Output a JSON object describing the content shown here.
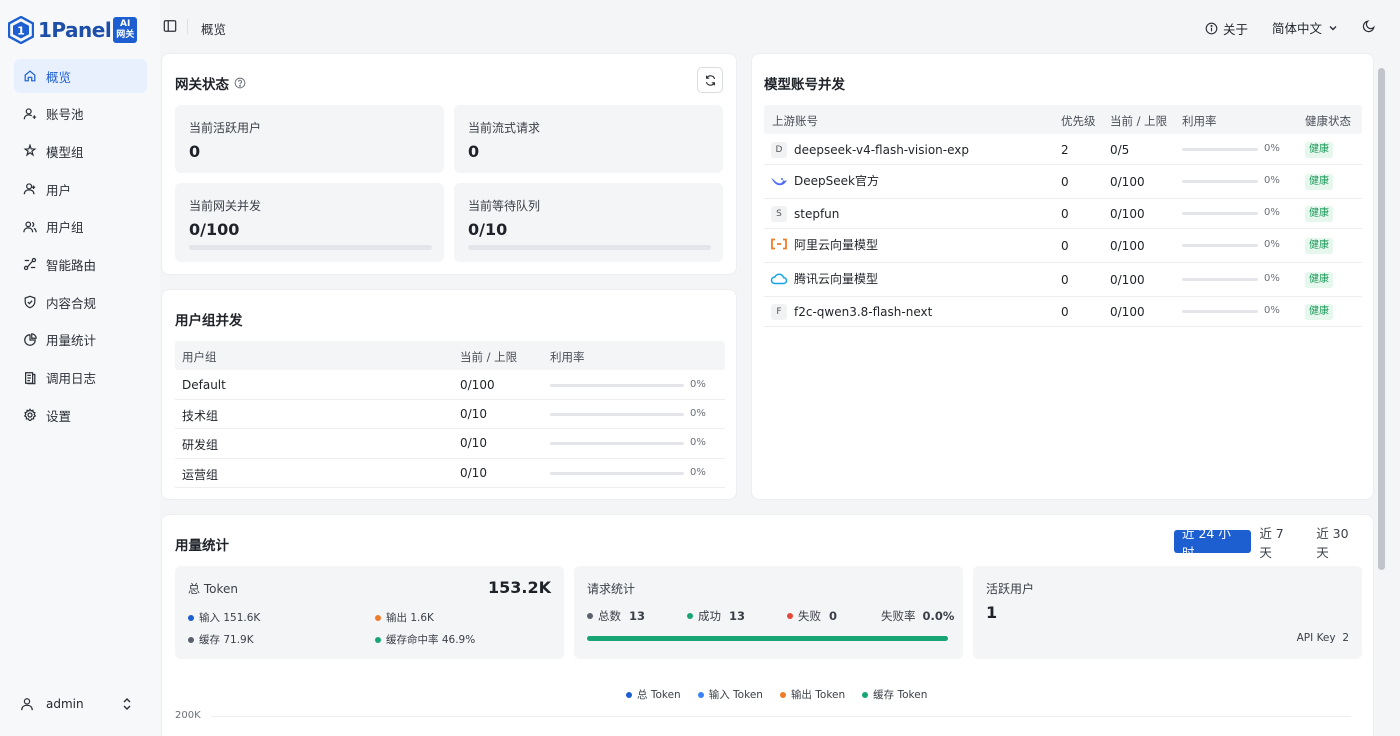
{
  "brand": {
    "name": "1Panel",
    "badge_top": "AI",
    "badge_bottom": "网关"
  },
  "sidebar": {
    "items": [
      {
        "label": "概览",
        "icon": "home-icon",
        "active": true
      },
      {
        "label": "账号池",
        "icon": "user-pool-icon"
      },
      {
        "label": "模型组",
        "icon": "model-group-icon"
      },
      {
        "label": "用户",
        "icon": "user-icon"
      },
      {
        "label": "用户组",
        "icon": "user-group-icon"
      },
      {
        "label": "智能路由",
        "icon": "route-icon"
      },
      {
        "label": "内容合规",
        "icon": "shield-icon"
      },
      {
        "label": "用量统计",
        "icon": "pie-chart-icon"
      },
      {
        "label": "调用日志",
        "icon": "log-icon"
      },
      {
        "label": "设置",
        "icon": "gear-icon"
      }
    ],
    "user": "admin"
  },
  "header": {
    "breadcrumb": "概览",
    "about": "关于",
    "language": "简体中文"
  },
  "gateway": {
    "title": "网关状态",
    "stats": [
      {
        "label": "当前活跃用户",
        "value": "0"
      },
      {
        "label": "当前流式请求",
        "value": "0"
      },
      {
        "label": "当前网关并发",
        "value": "0/100",
        "progress": 0
      },
      {
        "label": "当前等待队列",
        "value": "0/10",
        "progress": 0
      }
    ]
  },
  "user_groups": {
    "title": "用户组并发",
    "headers": [
      "用户组",
      "当前 / 上限",
      "利用率"
    ],
    "rows": [
      {
        "name": "Default",
        "limit": "0/100",
        "pct": "0%"
      },
      {
        "name": "技术组",
        "limit": "0/10",
        "pct": "0%"
      },
      {
        "name": "研发组",
        "limit": "0/10",
        "pct": "0%"
      },
      {
        "name": "运营组",
        "limit": "0/10",
        "pct": "0%"
      }
    ]
  },
  "model_accounts": {
    "title": "模型账号并发",
    "headers": [
      "上游账号",
      "优先级",
      "当前 / 上限",
      "利用率",
      "健康状态"
    ],
    "rows": [
      {
        "name": "deepseek-v4-flash-vision-exp",
        "icon": "D",
        "priority": "2",
        "limit": "0/5",
        "pct": "0%",
        "status": "健康"
      },
      {
        "name": "DeepSeek官方",
        "icon": "deepseek-icon",
        "priority": "0",
        "limit": "0/100",
        "pct": "0%",
        "status": "健康"
      },
      {
        "name": "stepfun",
        "icon": "S",
        "priority": "0",
        "limit": "0/100",
        "pct": "0%",
        "status": "健康"
      },
      {
        "name": "阿里云向量模型",
        "icon": "aliyun-icon",
        "priority": "0",
        "limit": "0/100",
        "pct": "0%",
        "status": "健康"
      },
      {
        "name": "腾讯云向量模型",
        "icon": "tencent-cloud-icon",
        "priority": "0",
        "limit": "0/100",
        "pct": "0%",
        "status": "健康"
      },
      {
        "name": "f2c-qwen3.8-flash-next",
        "icon": "F",
        "priority": "0",
        "limit": "0/100",
        "pct": "0%",
        "status": "健康"
      }
    ]
  },
  "usage": {
    "title": "用量统计",
    "ranges": [
      "近 24 小时",
      "近 7 天",
      "近 30 天"
    ],
    "active_range": 0,
    "token": {
      "label": "总 Token",
      "total": "153.2K",
      "input": "输入 151.6K",
      "output": "输出 1.6K",
      "cache": "缓存 71.9K",
      "cache_hit": "缓存命中率 46.9%"
    },
    "requests": {
      "label": "请求统计",
      "total_label": "总数",
      "total": "13",
      "success_label": "成功",
      "success": "13",
      "fail_label": "失败",
      "fail": "0",
      "fail_rate_label": "失败率",
      "fail_rate": "0.0%",
      "success_ratio": 1
    },
    "active_users": {
      "label": "活跃用户",
      "value": "1",
      "api_key_label": "API Key",
      "api_key": "2"
    },
    "legend": [
      {
        "name": "总 Token",
        "color": "#1d5fd1"
      },
      {
        "name": "输入 Token",
        "color": "#3b82f6"
      },
      {
        "name": "输出 Token",
        "color": "#f07c2a"
      },
      {
        "name": "缓存 Token",
        "color": "#17a673"
      }
    ],
    "y_top_label": "200K"
  },
  "colors": {
    "accent": "#1d5fd1",
    "success": "#17a673",
    "error": "#e5483b",
    "warning": "#f07c2a",
    "neutral": "#5b616b"
  }
}
